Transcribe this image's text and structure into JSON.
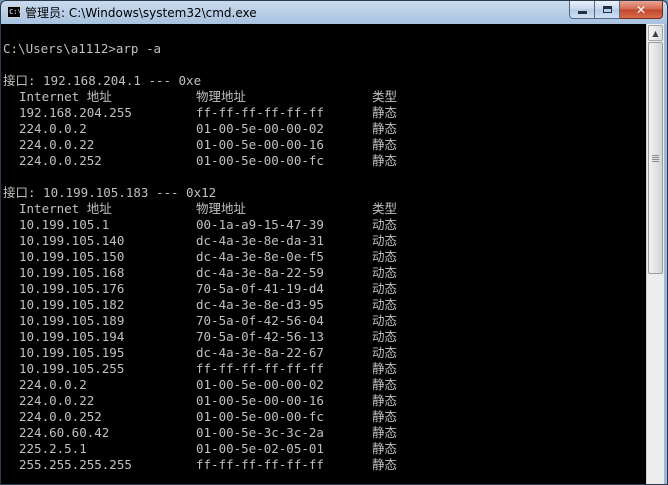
{
  "window": {
    "title": "管理员: C:\\Windows\\system32\\cmd.exe",
    "icon_text": "C:\\"
  },
  "console": {
    "command": "C:\\Users\\a1112>arp -a",
    "interfaces": [
      {
        "header": "接口: 192.168.204.1 --- 0xe",
        "col_headers": {
          "ip": "Internet 地址",
          "mac": "物理地址",
          "type": "类型"
        },
        "entries": [
          {
            "ip": "192.168.204.255",
            "mac": "ff-ff-ff-ff-ff-ff",
            "type": "静态"
          },
          {
            "ip": "224.0.0.2",
            "mac": "01-00-5e-00-00-02",
            "type": "静态"
          },
          {
            "ip": "224.0.0.22",
            "mac": "01-00-5e-00-00-16",
            "type": "静态"
          },
          {
            "ip": "224.0.0.252",
            "mac": "01-00-5e-00-00-fc",
            "type": "静态"
          }
        ]
      },
      {
        "header": "接口: 10.199.105.183 --- 0x12",
        "col_headers": {
          "ip": "Internet 地址",
          "mac": "物理地址",
          "type": "类型"
        },
        "entries": [
          {
            "ip": "10.199.105.1",
            "mac": "00-1a-a9-15-47-39",
            "type": "动态"
          },
          {
            "ip": "10.199.105.140",
            "mac": "dc-4a-3e-8e-da-31",
            "type": "动态"
          },
          {
            "ip": "10.199.105.150",
            "mac": "dc-4a-3e-8e-0e-f5",
            "type": "动态"
          },
          {
            "ip": "10.199.105.168",
            "mac": "dc-4a-3e-8a-22-59",
            "type": "动态"
          },
          {
            "ip": "10.199.105.176",
            "mac": "70-5a-0f-41-19-d4",
            "type": "动态"
          },
          {
            "ip": "10.199.105.182",
            "mac": "dc-4a-3e-8e-d3-95",
            "type": "动态"
          },
          {
            "ip": "10.199.105.189",
            "mac": "70-5a-0f-42-56-04",
            "type": "动态"
          },
          {
            "ip": "10.199.105.194",
            "mac": "70-5a-0f-42-56-13",
            "type": "动态"
          },
          {
            "ip": "10.199.105.195",
            "mac": "dc-4a-3e-8a-22-67",
            "type": "动态"
          },
          {
            "ip": "10.199.105.255",
            "mac": "ff-ff-ff-ff-ff-ff",
            "type": "静态"
          },
          {
            "ip": "224.0.0.2",
            "mac": "01-00-5e-00-00-02",
            "type": "静态"
          },
          {
            "ip": "224.0.0.22",
            "mac": "01-00-5e-00-00-16",
            "type": "静态"
          },
          {
            "ip": "224.0.0.252",
            "mac": "01-00-5e-00-00-fc",
            "type": "静态"
          },
          {
            "ip": "224.60.60.42",
            "mac": "01-00-5e-3c-3c-2a",
            "type": "静态"
          },
          {
            "ip": "225.2.5.1",
            "mac": "01-00-5e-02-05-01",
            "type": "静态"
          },
          {
            "ip": "255.255.255.255",
            "mac": "ff-ff-ff-ff-ff-ff",
            "type": "静态"
          }
        ]
      }
    ]
  },
  "colors": {
    "console_bg": "#000000",
    "console_text": "#c0c0c0",
    "close_button": "#c2472c"
  },
  "icons": {
    "minimize": "minimize-icon",
    "maximize": "maximize-icon",
    "close": "close-icon",
    "scroll_up": "arrow-up-icon",
    "scroll_down": "arrow-down-icon"
  }
}
